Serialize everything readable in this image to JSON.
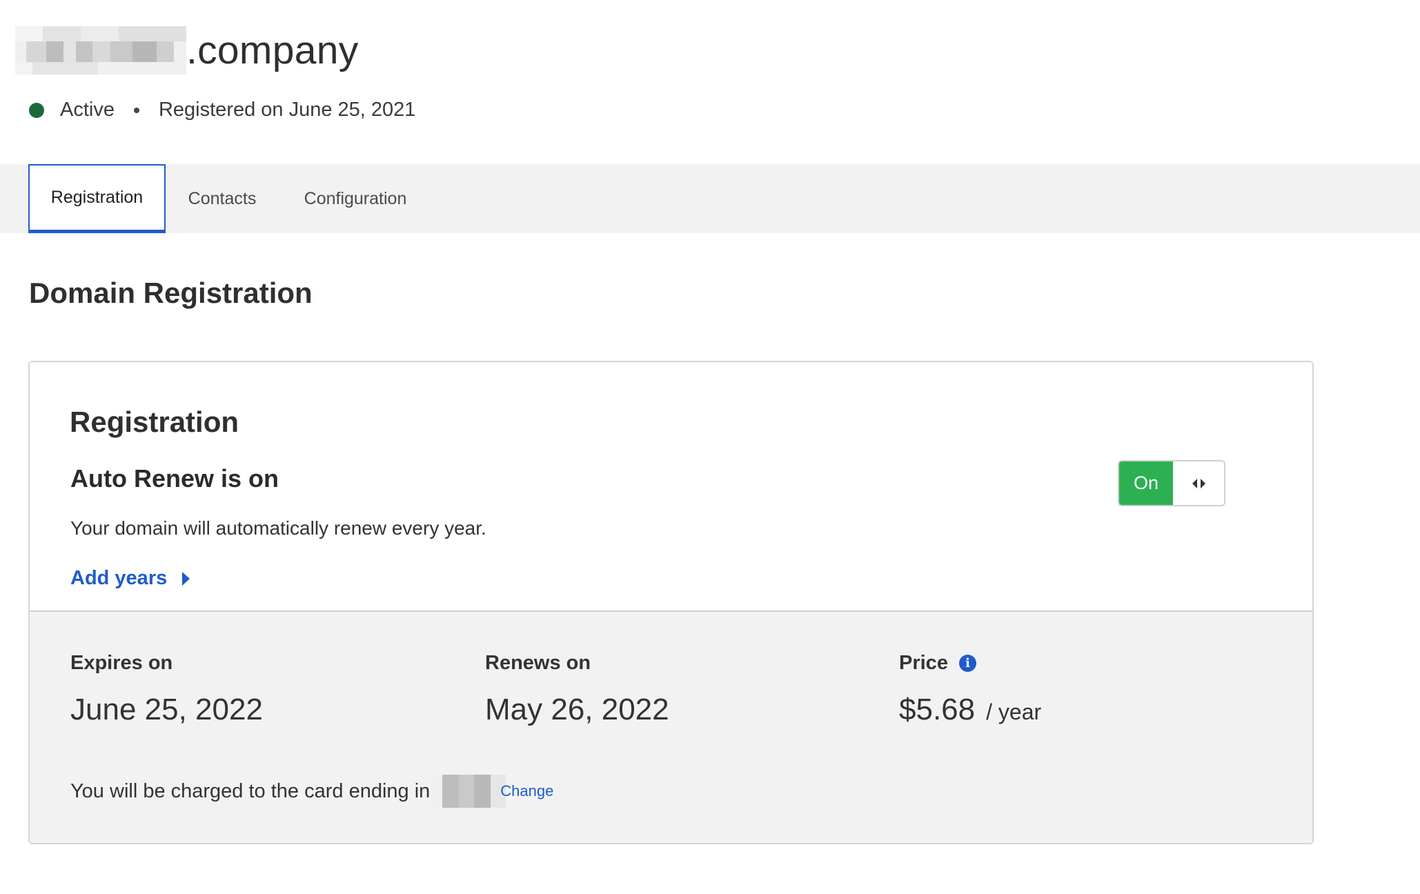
{
  "header": {
    "domain_suffix": ".company",
    "status": "Active",
    "registered": "Registered on June 25, 2021"
  },
  "tabs": [
    "Registration",
    "Contacts",
    "Configuration"
  ],
  "section_title": "Domain Registration",
  "card": {
    "heading": "Registration",
    "auto_renew_title": "Auto Renew is on",
    "auto_renew_desc": "Your domain will automatically renew every year.",
    "add_years": "Add years",
    "toggle_label": "On",
    "expires_label": "Expires on",
    "expires_value": "June 25, 2022",
    "renews_label": "Renews on",
    "renews_value": "May 26, 2022",
    "price_label": "Price",
    "price_value": "$5.68",
    "price_unit": "/ year",
    "charge_text": "You will be charged to the card ending in",
    "change_link": "Change"
  },
  "colors": {
    "accent": "#1f5cc9",
    "active_status": "#1a6b3a",
    "toggle_on": "#2db052"
  },
  "icons": [
    "status-dot-icon",
    "info-icon",
    "chevron-right-icon",
    "toggle-handle-icon"
  ]
}
